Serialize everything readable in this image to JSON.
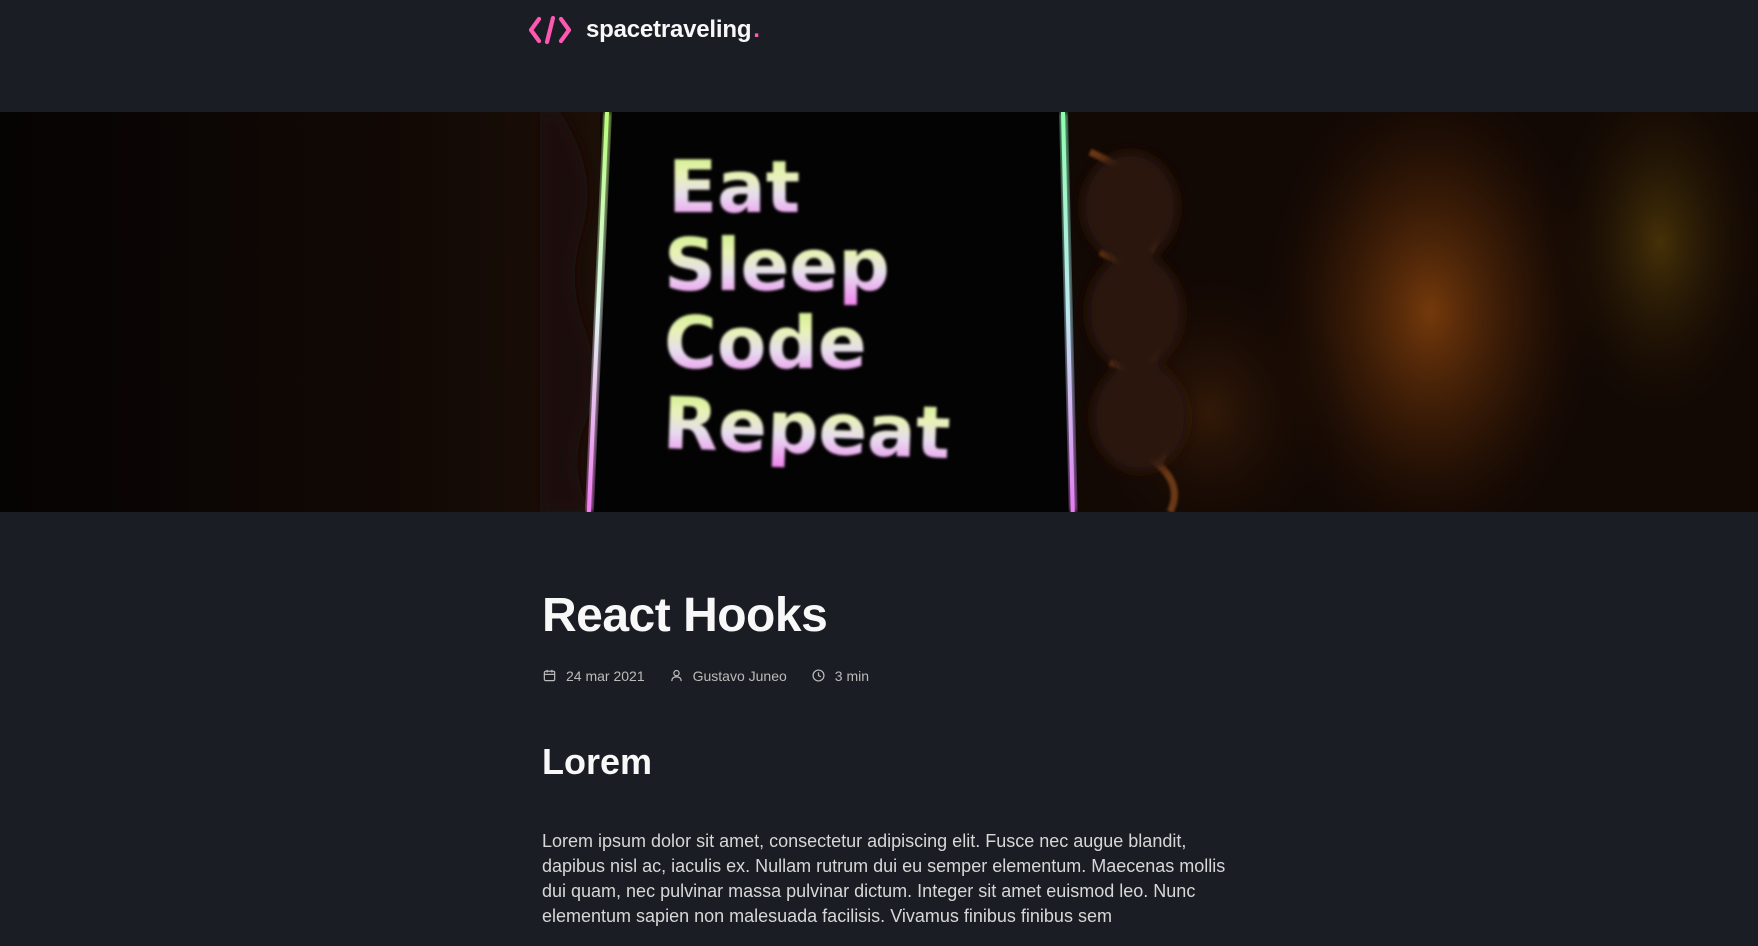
{
  "header": {
    "logo_text": "spacetraveling",
    "logo_dot": ".",
    "accent_color": "#ff57b2"
  },
  "banner": {
    "image_alt": "Eat Sleep Code Repeat",
    "lines": [
      "Eat",
      "Sleep",
      "Code",
      "Repeat"
    ]
  },
  "post": {
    "title": "React Hooks",
    "meta": {
      "date": "24 mar 2021",
      "author": "Gustavo Juneo",
      "reading_time": "3 min"
    },
    "sections": [
      {
        "heading": "Lorem",
        "body": "Lorem ipsum dolor sit amet, consectetur adipiscing elit. Fusce nec augue blandit, dapibus nisl ac, iaculis ex. Nullam rutrum dui eu semper elementum. Maecenas mollis dui quam, nec pulvinar massa pulvinar dictum. Integer sit amet euismod leo. Nunc elementum sapien non malesuada facilisis. Vivamus finibus finibus sem"
      }
    ]
  },
  "icons": {
    "logo": "code-brackets-icon",
    "date": "calendar-icon",
    "author": "user-icon",
    "reading_time": "clock-icon"
  }
}
